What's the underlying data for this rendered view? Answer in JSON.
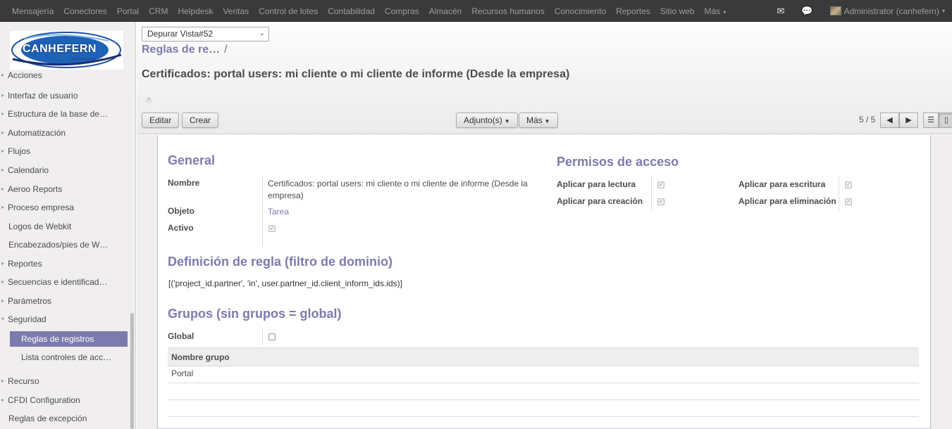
{
  "topbar": {
    "menu": [
      "Mensajería",
      "Conectores",
      "Portal",
      "CRM",
      "Helpdesk",
      "Ventas",
      "Control de lotes",
      "Contabilidad",
      "Compras",
      "Almacén",
      "Recursos humanos",
      "Conocimiento",
      "Reportes",
      "Sitio web"
    ],
    "more_label": "Más",
    "user_label": "Administrator (canhefern)"
  },
  "sidebar": {
    "logo_text": "CANHEFERN",
    "logo_subtext": "LABORATORIO DE CALIBRACIÓN",
    "items": [
      {
        "label": "Acciones"
      },
      {
        "label": "Interfaz de usuario"
      },
      {
        "label": "Estructura de la base de…"
      },
      {
        "label": "Automatización"
      },
      {
        "label": "Flujos"
      },
      {
        "label": "Calendario"
      },
      {
        "label": "Aeroo Reports"
      },
      {
        "label": "Proceso empresa"
      },
      {
        "label": "Logos de Webkit"
      },
      {
        "label": "Encabezados/pies de W…"
      },
      {
        "label": "Reportes"
      },
      {
        "label": "Secuencias e identificad…"
      },
      {
        "label": "Parámetros"
      },
      {
        "label": "Seguridad"
      },
      {
        "label": "Reglas de registros"
      },
      {
        "label": "Lista controles de acc…"
      },
      {
        "label": "Recurso"
      },
      {
        "label": "CFDI Configuration"
      },
      {
        "label": "Reglas de excepción"
      }
    ]
  },
  "control_panel": {
    "debug_select": "Depurar Vista#52",
    "breadcrumb": "Reglas de re…",
    "breadcrumb_sep": "/",
    "title": "Certificados: portal users: mi cliente o mi cliente de informe (Desde la empresa)",
    "help": "?",
    "edit_label": "Editar",
    "create_label": "Crear",
    "attachments_label": "Adjunto(s)",
    "more_label": "Más",
    "pager": "5 / 5"
  },
  "form": {
    "general_heading": "General",
    "nombre_label": "Nombre",
    "nombre_value": "Certificados: portal users: mi cliente o mi cliente de informe (Desde la empresa)",
    "objeto_label": "Objeto",
    "objeto_value": "Tarea",
    "activo_label": "Activo",
    "activo_checked": true,
    "permisos_heading": "Permisos de acceso",
    "perm_read_label": "Aplicar para lectura",
    "perm_write_label": "Aplicar para escritura",
    "perm_create_label": "Aplicar para creación",
    "perm_delete_label": "Aplicar para eliminación",
    "domain_heading": "Definición de regla (filtro de dominio)",
    "domain_value": "[('project_id.partner', 'in', user.partner_id.client_inform_ids.ids)]",
    "groups_heading": "Grupos (sin grupos = global)",
    "global_label": "Global",
    "global_checked": false,
    "groups_column": "Nombre grupo",
    "groups_rows": [
      "Portal"
    ]
  },
  "colors": {
    "accent": "#7c7bad",
    "topbar": "#3a3a3a",
    "sidebar_bg": "#f0eeee"
  }
}
